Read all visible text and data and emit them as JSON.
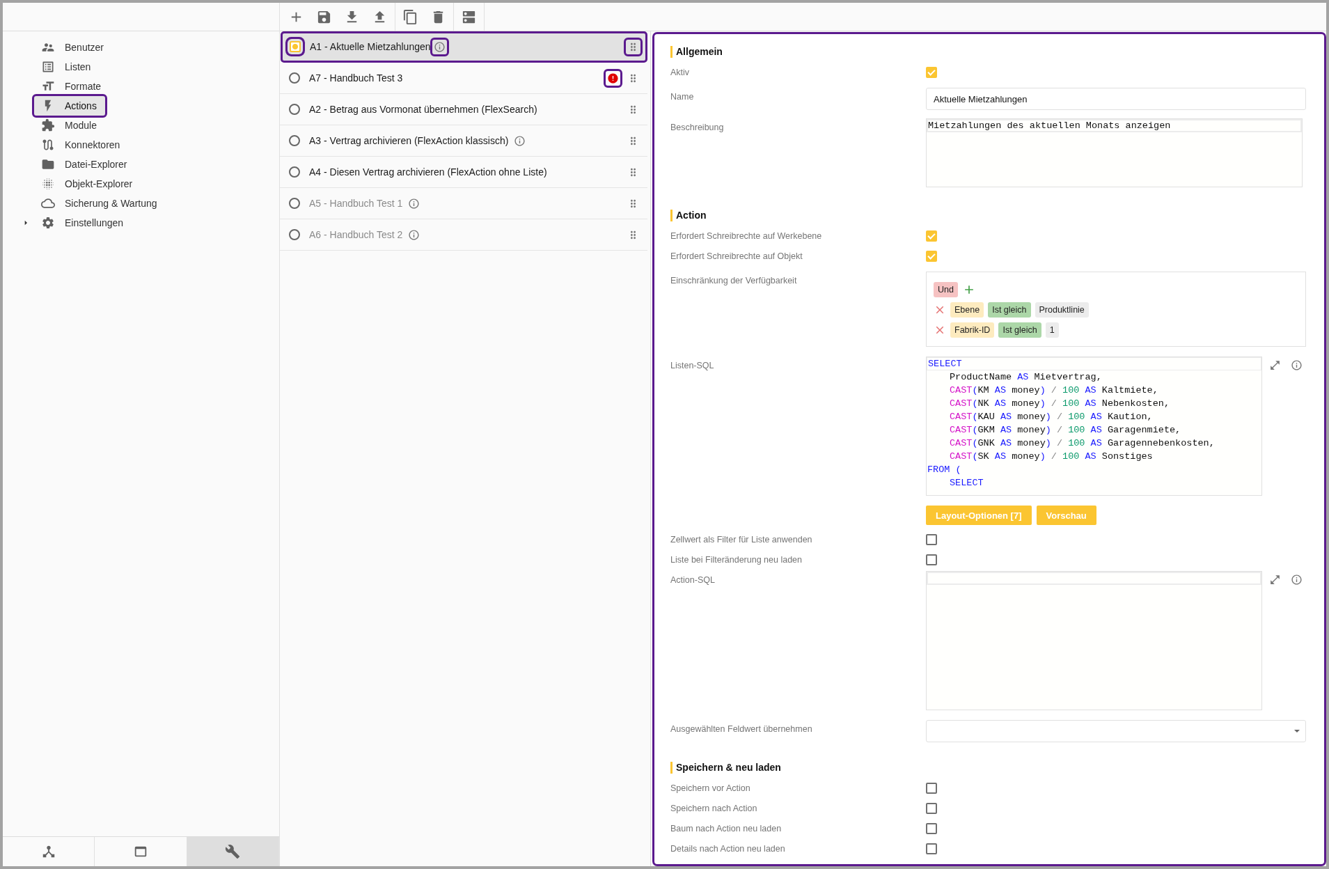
{
  "sidebar": {
    "items": [
      {
        "label": "Benutzer",
        "kind": "item",
        "selected": false,
        "highlighted": false
      },
      {
        "label": "Listen",
        "kind": "item",
        "selected": false,
        "highlighted": false
      },
      {
        "label": "Formate",
        "kind": "item",
        "selected": false,
        "highlighted": false
      },
      {
        "label": "Actions",
        "kind": "item",
        "selected": true,
        "highlighted": true
      },
      {
        "label": "Module",
        "kind": "item",
        "selected": false,
        "highlighted": false
      },
      {
        "label": "Konnektoren",
        "kind": "item",
        "selected": false,
        "highlighted": false
      },
      {
        "label": "Datei-Explorer",
        "kind": "item",
        "selected": false,
        "highlighted": false
      },
      {
        "label": "Objekt-Explorer",
        "kind": "item",
        "selected": false,
        "highlighted": false
      },
      {
        "label": "Sicherung & Wartung",
        "kind": "item",
        "selected": false,
        "highlighted": false
      },
      {
        "label": "Einstellungen",
        "kind": "group",
        "selected": false,
        "highlighted": false
      }
    ],
    "bottom_tabs": [
      {
        "selected": false
      },
      {
        "selected": false
      },
      {
        "selected": true
      }
    ]
  },
  "actions": [
    {
      "label": "A1 - Aktuelle Mietzahlungen",
      "selected": true,
      "disabled": false,
      "highlighted": true,
      "info": {
        "highlighted": true
      }
    },
    {
      "label": "A7 - Handbuch Test 3",
      "selected": false,
      "disabled": false,
      "highlighted": false,
      "error": {
        "highlighted": true
      }
    },
    {
      "label": "A2 - Betrag aus Vormonat übernehmen (FlexSearch)",
      "selected": false,
      "disabled": false,
      "highlighted": false
    },
    {
      "label": "A3 - Vertrag archivieren (FlexAction klassisch)",
      "selected": false,
      "disabled": false,
      "highlighted": false,
      "info": {
        "highlighted": false
      }
    },
    {
      "label": "A4 - Diesen Vertrag archivieren (FlexAction ohne Liste)",
      "selected": false,
      "disabled": false,
      "highlighted": false
    },
    {
      "label": "A5 - Handbuch Test 1",
      "selected": false,
      "disabled": true,
      "highlighted": false,
      "info": {
        "highlighted": false
      }
    },
    {
      "label": "A6 - Handbuch Test 2",
      "selected": false,
      "disabled": true,
      "highlighted": false,
      "info": {
        "highlighted": false
      }
    }
  ],
  "details": {
    "highlighted": true,
    "sections": [
      {
        "title": "Allgemein",
        "rows": [
          {
            "kind": "checkbox",
            "label": "Aktiv",
            "checked": true
          },
          {
            "kind": "text",
            "label": "Name",
            "value": "Aktuelle Mietzahlungen"
          },
          {
            "kind": "textarea",
            "label": "Beschreibung",
            "value": "Mietzahlungen des aktuellen Monats anzeigen"
          }
        ]
      },
      {
        "title": "Action",
        "rows": [
          {
            "kind": "checkbox",
            "label": "Erfordert Schreibrechte auf Werkebene",
            "checked": true
          },
          {
            "kind": "checkbox",
            "label": "Erfordert Schreibrechte auf Objekt",
            "checked": true
          },
          {
            "kind": "conditions",
            "label": "Einschränkung der Verfügbarkeit",
            "operator": "Und",
            "conditions": [
              {
                "field": "Ebene",
                "comparison": "Ist gleich",
                "value": "Produktlinie"
              },
              {
                "field": "Fabrik-ID",
                "comparison": "Ist gleich",
                "value": "1"
              }
            ]
          },
          {
            "kind": "code",
            "label": "Listen-SQL",
            "lines": [
              {
                "nested": false,
                "tokens": [
                  {
                    "kind": "keyword",
                    "text": "SELECT"
                  }
                ]
              },
              {
                "nested": true,
                "tokens": [
                  {
                    "kind": "plain",
                    "text": "ProductName "
                  },
                  {
                    "kind": "keyword",
                    "text": "AS"
                  },
                  {
                    "kind": "plain",
                    "text": " Mietvertrag,"
                  }
                ]
              },
              {
                "nested": true,
                "tokens": [
                  {
                    "kind": "function",
                    "text": "CAST"
                  },
                  {
                    "kind": "keyword",
                    "text": "("
                  },
                  {
                    "kind": "plain",
                    "text": "KM "
                  },
                  {
                    "kind": "keyword",
                    "text": "AS"
                  },
                  {
                    "kind": "plain",
                    "text": " money"
                  },
                  {
                    "kind": "keyword",
                    "text": ")"
                  },
                  {
                    "kind": "operator",
                    "text": " / "
                  },
                  {
                    "kind": "number",
                    "text": "100"
                  },
                  {
                    "kind": "keyword",
                    "text": " AS"
                  },
                  {
                    "kind": "plain",
                    "text": " Kaltmiete,"
                  }
                ]
              },
              {
                "nested": true,
                "tokens": [
                  {
                    "kind": "function",
                    "text": "CAST"
                  },
                  {
                    "kind": "keyword",
                    "text": "("
                  },
                  {
                    "kind": "plain",
                    "text": "NK "
                  },
                  {
                    "kind": "keyword",
                    "text": "AS"
                  },
                  {
                    "kind": "plain",
                    "text": " money"
                  },
                  {
                    "kind": "keyword",
                    "text": ")"
                  },
                  {
                    "kind": "operator",
                    "text": " / "
                  },
                  {
                    "kind": "number",
                    "text": "100"
                  },
                  {
                    "kind": "keyword",
                    "text": " AS"
                  },
                  {
                    "kind": "plain",
                    "text": " Nebenkosten,"
                  }
                ]
              },
              {
                "nested": true,
                "tokens": [
                  {
                    "kind": "function",
                    "text": "CAST"
                  },
                  {
                    "kind": "keyword",
                    "text": "("
                  },
                  {
                    "kind": "plain",
                    "text": "KAU "
                  },
                  {
                    "kind": "keyword",
                    "text": "AS"
                  },
                  {
                    "kind": "plain",
                    "text": " money"
                  },
                  {
                    "kind": "keyword",
                    "text": ")"
                  },
                  {
                    "kind": "operator",
                    "text": " / "
                  },
                  {
                    "kind": "number",
                    "text": "100"
                  },
                  {
                    "kind": "keyword",
                    "text": " AS"
                  },
                  {
                    "kind": "plain",
                    "text": " Kaution,"
                  }
                ]
              },
              {
                "nested": true,
                "tokens": [
                  {
                    "kind": "function",
                    "text": "CAST"
                  },
                  {
                    "kind": "keyword",
                    "text": "("
                  },
                  {
                    "kind": "plain",
                    "text": "GKM "
                  },
                  {
                    "kind": "keyword",
                    "text": "AS"
                  },
                  {
                    "kind": "plain",
                    "text": " money"
                  },
                  {
                    "kind": "keyword",
                    "text": ")"
                  },
                  {
                    "kind": "operator",
                    "text": " / "
                  },
                  {
                    "kind": "number",
                    "text": "100"
                  },
                  {
                    "kind": "keyword",
                    "text": " AS"
                  },
                  {
                    "kind": "plain",
                    "text": " Garagenmiete,"
                  }
                ]
              },
              {
                "nested": true,
                "tokens": [
                  {
                    "kind": "function",
                    "text": "CAST"
                  },
                  {
                    "kind": "keyword",
                    "text": "("
                  },
                  {
                    "kind": "plain",
                    "text": "GNK "
                  },
                  {
                    "kind": "keyword",
                    "text": "AS"
                  },
                  {
                    "kind": "plain",
                    "text": " money"
                  },
                  {
                    "kind": "keyword",
                    "text": ")"
                  },
                  {
                    "kind": "operator",
                    "text": " / "
                  },
                  {
                    "kind": "number",
                    "text": "100"
                  },
                  {
                    "kind": "keyword",
                    "text": " AS"
                  },
                  {
                    "kind": "plain",
                    "text": " Garagennebenkosten,"
                  }
                ]
              },
              {
                "nested": true,
                "tokens": [
                  {
                    "kind": "function",
                    "text": "CAST"
                  },
                  {
                    "kind": "keyword",
                    "text": "("
                  },
                  {
                    "kind": "plain",
                    "text": "SK "
                  },
                  {
                    "kind": "keyword",
                    "text": "AS"
                  },
                  {
                    "kind": "plain",
                    "text": " money"
                  },
                  {
                    "kind": "keyword",
                    "text": ")"
                  },
                  {
                    "kind": "operator",
                    "text": " / "
                  },
                  {
                    "kind": "number",
                    "text": "100"
                  },
                  {
                    "kind": "keyword",
                    "text": " AS"
                  },
                  {
                    "kind": "plain",
                    "text": " Sonstiges"
                  }
                ]
              },
              {
                "nested": false,
                "tokens": [
                  {
                    "kind": "keyword",
                    "text": "FROM ("
                  }
                ]
              },
              {
                "nested": true,
                "tokens": [
                  {
                    "kind": "keyword",
                    "text": "SELECT"
                  }
                ]
              }
            ]
          },
          {
            "kind": "buttons",
            "buttons": [
              "Layout-Optionen [7]",
              "Vorschau"
            ]
          },
          {
            "kind": "checkbox",
            "label": "Zellwert als Filter für Liste anwenden",
            "checked": false
          },
          {
            "kind": "checkbox",
            "label": "Liste bei Filteränderung neu laden",
            "checked": false
          },
          {
            "kind": "code",
            "label": "Action-SQL"
          },
          {
            "kind": "select",
            "label": "Ausgewählten Feldwert übernehmen"
          }
        ]
      },
      {
        "title": "Speichern & neu laden",
        "rows": [
          {
            "kind": "checkbox",
            "label": "Speichern vor Action",
            "checked": false
          },
          {
            "kind": "checkbox",
            "label": "Speichern nach Action",
            "checked": false
          },
          {
            "kind": "checkbox",
            "label": "Baum nach Action neu laden",
            "checked": false
          },
          {
            "kind": "checkbox",
            "label": "Details nach Action neu laden",
            "checked": false
          }
        ]
      }
    ]
  }
}
